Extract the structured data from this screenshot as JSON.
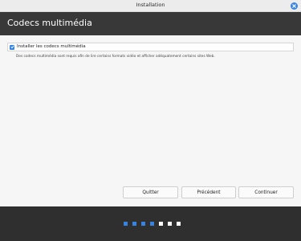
{
  "window": {
    "title": "Installation"
  },
  "header": {
    "title": "Codecs multimédia"
  },
  "option": {
    "label": "Installer les codecs multimédia",
    "checked": true,
    "description": "Des codecs multimédia sont requis afin de lire certains formats vidéo et afficher adéquatement certains sites Web."
  },
  "buttons": {
    "quit": "Quitter",
    "previous": "Précédent",
    "continue": "Continuer"
  },
  "progress": {
    "total_steps": 7,
    "completed_steps": 4
  },
  "colors": {
    "accent": "#3584e4",
    "header_bg": "#383838",
    "footer_bg": "#2f2f2f",
    "step_inactive": "#ffffff"
  },
  "icons": {
    "close": "close-icon",
    "checkbox": "checkmark-icon"
  }
}
